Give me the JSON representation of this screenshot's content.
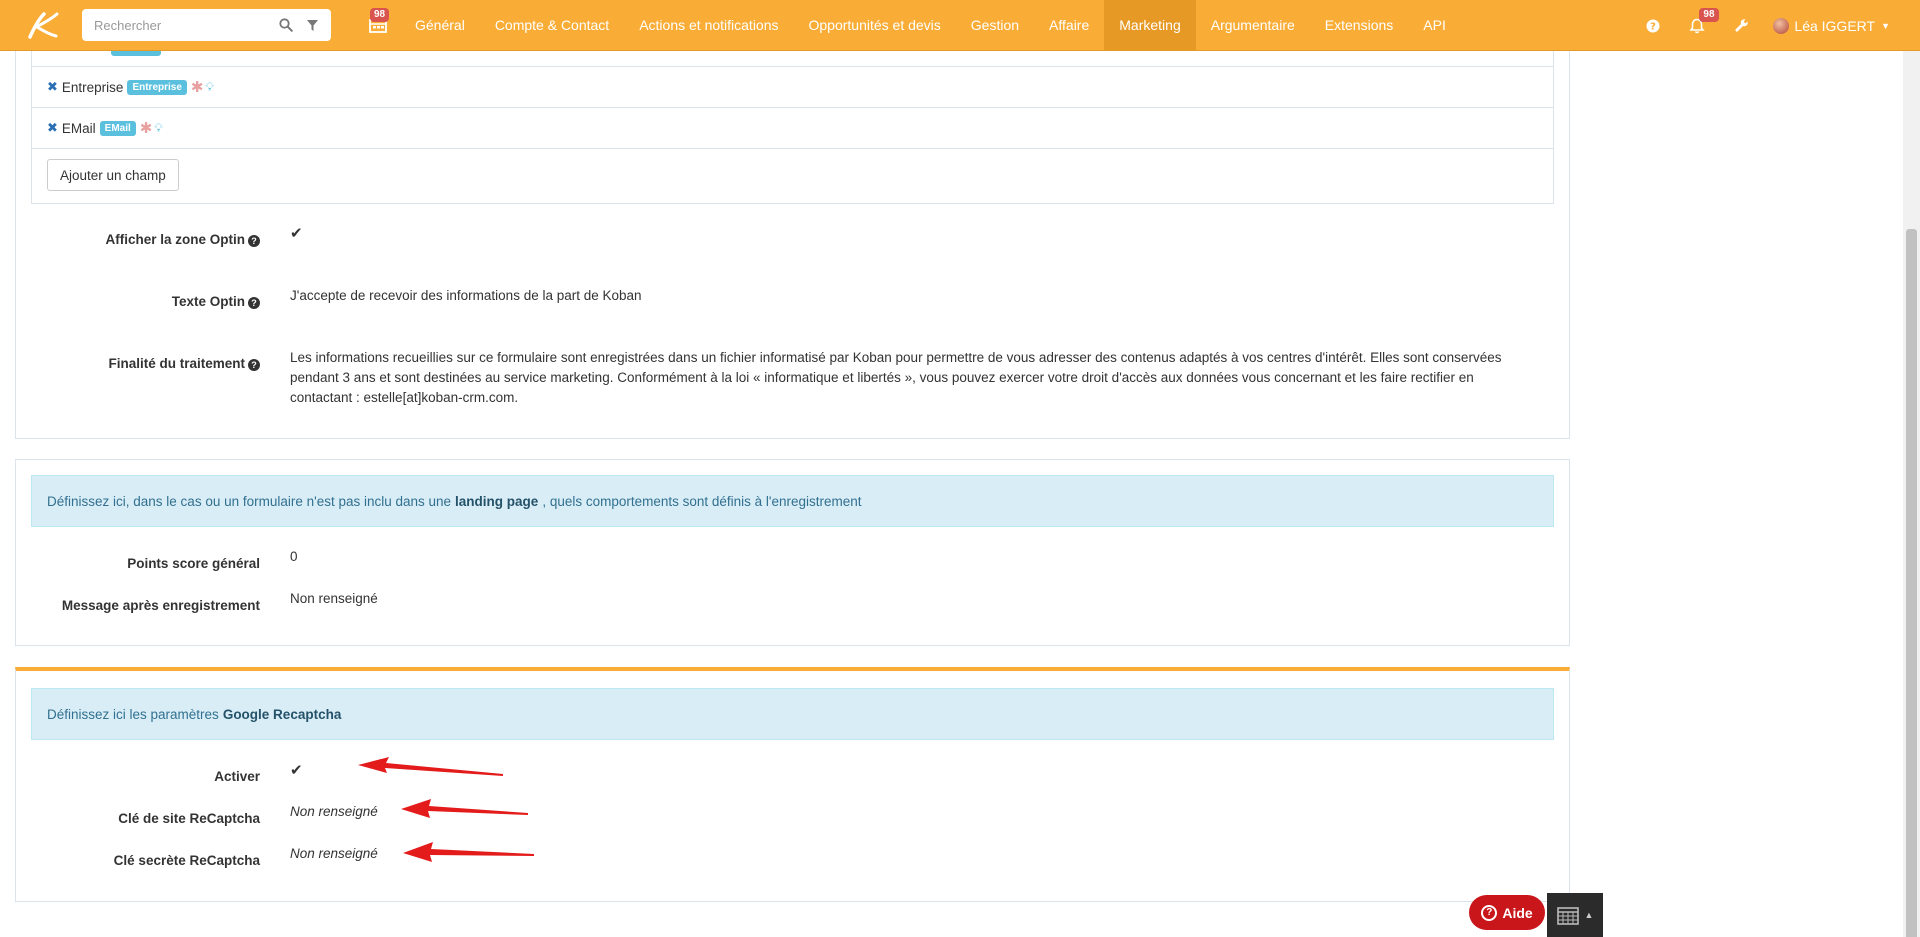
{
  "nav": {
    "search_placeholder": "Rechercher",
    "calendar_badge": "98",
    "items": [
      "Général",
      "Compte & Contact",
      "Actions et notifications",
      "Opportunités et devis",
      "Gestion",
      "Affaire",
      "Marketing",
      "Argumentaire",
      "Extensions",
      "API"
    ],
    "active_item": "Marketing",
    "notif_badge": "98",
    "user_name": "Léa IGGERT"
  },
  "fields": {
    "rows": [
      {
        "label": "Entreprise",
        "tag": "Entreprise"
      },
      {
        "label": "EMail",
        "tag": "EMail"
      }
    ],
    "add_button": "Ajouter un champ"
  },
  "optin": {
    "show_label": "Afficher la zone Optin",
    "text_label": "Texte Optin",
    "text_value": "J'accepte de recevoir des informations de la part de Koban",
    "purpose_label": "Finalité du traitement",
    "purpose_value": "Les informations recueillies sur ce formulaire sont enregistrées dans un fichier informatisé par Koban pour permettre de vous adresser des contenus adaptés à vos centres d'intérêt. Elles sont conservées pendant 3 ans et sont destinées au service marketing. Conformément à la loi « informatique et libertés », vous pouvez exercer votre droit d'accès aux données vous concernant et les faire rectifier en contactant : estelle[at]koban-crm.com."
  },
  "registration": {
    "info_prefix": "Définissez ici, dans le cas ou un formulaire n'est pas inclu dans une",
    "info_bold": "landing page",
    "info_suffix": ", quels comportements sont définis à l'enregistrement",
    "score_label": "Points score général",
    "score_value": "0",
    "message_label": "Message après enregistrement",
    "message_value": "Non renseigné"
  },
  "recaptcha": {
    "info_prefix": "Définissez ici les paramètres",
    "info_bold": "Google Recaptcha",
    "activate_label": "Activer",
    "site_key_label": "Clé de site ReCaptcha",
    "site_key_value": "Non renseigné",
    "secret_key_label": "Clé secrète ReCaptcha",
    "secret_key_value": "Non renseigné"
  },
  "footer": {
    "aide_label": "Aide"
  },
  "colors": {
    "navbar": "#f9ad36",
    "navbar_active": "#e69a25",
    "info_bg": "#d9edf7",
    "tag": "#5bc0de",
    "aide": "#c9161b",
    "arrow": "#e31b1b"
  }
}
